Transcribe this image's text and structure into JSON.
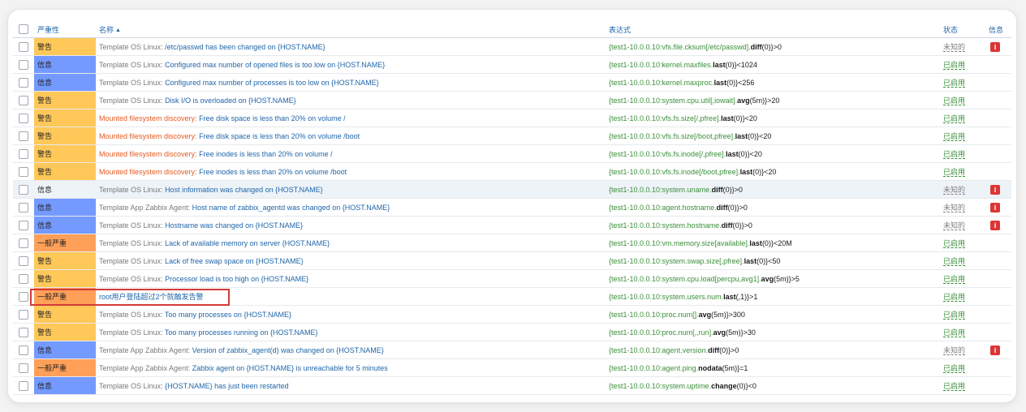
{
  "table": {
    "headers": {
      "severity": "严重性",
      "name": "名称",
      "expression": "表达式",
      "status": "状态",
      "info": "信息"
    },
    "rows": [
      {
        "severity": "警告",
        "sev_class": "warning",
        "template": "Template OS Linux",
        "name": "/etc/passwd has been changed on {HOST.NAME}",
        "expr_host": "{test1-10.0.0.10:vfs.file.cksum[/etc/passwd].",
        "expr_func": "diff",
        "expr_tail": "(0)}>0",
        "status": "未知的",
        "status_class": "unknown",
        "info": "i"
      },
      {
        "severity": "信息",
        "sev_class": "info",
        "template": "Template OS Linux",
        "name": "Configured max number of opened files is too low on {HOST.NAME}",
        "expr_host": "{test1-10.0.0.10:kernel.maxfiles.",
        "expr_func": "last",
        "expr_tail": "(0)}<1024",
        "status": "已启用",
        "status_class": "enabled",
        "info": ""
      },
      {
        "severity": "信息",
        "sev_class": "info",
        "template": "Template OS Linux",
        "name": "Configured max number of processes is too low on {HOST.NAME}",
        "expr_host": "{test1-10.0.0.10:kernel.maxproc.",
        "expr_func": "last",
        "expr_tail": "(0)}<256",
        "status": "已启用",
        "status_class": "enabled",
        "info": ""
      },
      {
        "severity": "警告",
        "sev_class": "warning",
        "template": "Template OS Linux",
        "name": "Disk I/O is overloaded on {HOST.NAME}",
        "expr_host": "{test1-10.0.0.10:system.cpu.util[,iowait].",
        "expr_func": "avg",
        "expr_tail": "(5m)}>20",
        "status": "已启用",
        "status_class": "enabled",
        "info": ""
      },
      {
        "severity": "警告",
        "sev_class": "warning",
        "template": "Mounted filesystem discovery",
        "template_class": "disc",
        "name": "Free disk space is less than 20% on volume /",
        "expr_host": "{test1-10.0.0.10:vfs.fs.size[/,pfree].",
        "expr_func": "last",
        "expr_tail": "(0)}<20",
        "status": "已启用",
        "status_class": "enabled",
        "info": ""
      },
      {
        "severity": "警告",
        "sev_class": "warning",
        "template": "Mounted filesystem discovery",
        "template_class": "disc",
        "name": "Free disk space is less than 20% on volume /boot",
        "expr_host": "{test1-10.0.0.10:vfs.fs.size[/boot,pfree].",
        "expr_func": "last",
        "expr_tail": "(0)}<20",
        "status": "已启用",
        "status_class": "enabled",
        "info": ""
      },
      {
        "severity": "警告",
        "sev_class": "warning",
        "template": "Mounted filesystem discovery",
        "template_class": "disc",
        "name": "Free inodes is less than 20% on volume /",
        "expr_host": "{test1-10.0.0.10:vfs.fs.inode[/,pfree].",
        "expr_func": "last",
        "expr_tail": "(0)}<20",
        "status": "已启用",
        "status_class": "enabled",
        "info": ""
      },
      {
        "severity": "警告",
        "sev_class": "warning",
        "template": "Mounted filesystem discovery",
        "template_class": "disc",
        "name": "Free inodes is less than 20% on volume /boot",
        "expr_host": "{test1-10.0.0.10:vfs.fs.inode[/boot,pfree].",
        "expr_func": "last",
        "expr_tail": "(0)}<20",
        "status": "已启用",
        "status_class": "enabled",
        "info": ""
      },
      {
        "severity": "信息",
        "sev_class": "info",
        "template": "Template OS Linux",
        "name": "Host information was changed on {HOST.NAME}",
        "expr_host": "{test1-10.0.0.10:system.uname.",
        "expr_func": "diff",
        "expr_tail": "(0)}>0",
        "status": "未知的",
        "status_class": "unknown",
        "info": "i",
        "highlight": true
      },
      {
        "severity": "信息",
        "sev_class": "info",
        "template": "Template App Zabbix Agent",
        "name": "Host name of zabbix_agentd was changed on {HOST.NAME}",
        "expr_host": "{test1-10.0.0.10:agent.hostname.",
        "expr_func": "diff",
        "expr_tail": "(0)}>0",
        "status": "未知的",
        "status_class": "unknown",
        "info": "i"
      },
      {
        "severity": "信息",
        "sev_class": "info",
        "template": "Template OS Linux",
        "name": "Hostname was changed on {HOST.NAME}",
        "expr_host": "{test1-10.0.0.10:system.hostname.",
        "expr_func": "diff",
        "expr_tail": "(0)}>0",
        "status": "未知的",
        "status_class": "unknown",
        "info": "i"
      },
      {
        "severity": "一般严重",
        "sev_class": "average",
        "template": "Template OS Linux",
        "name": "Lack of available memory on server {HOST.NAME}",
        "expr_host": "{test1-10.0.0.10:vm.memory.size[available].",
        "expr_func": "last",
        "expr_tail": "(0)}<20M",
        "status": "已启用",
        "status_class": "enabled",
        "info": ""
      },
      {
        "severity": "警告",
        "sev_class": "warning",
        "template": "Template OS Linux",
        "name": "Lack of free swap space on {HOST.NAME}",
        "expr_host": "{test1-10.0.0.10:system.swap.size[,pfree].",
        "expr_func": "last",
        "expr_tail": "(0)}<50",
        "status": "已启用",
        "status_class": "enabled",
        "info": ""
      },
      {
        "severity": "警告",
        "sev_class": "warning",
        "template": "Template OS Linux",
        "name": "Processor load is too high on {HOST.NAME}",
        "expr_host": "{test1-10.0.0.10:system.cpu.load[percpu,avg1].",
        "expr_func": "avg",
        "expr_tail": "(5m)}>5",
        "status": "已启用",
        "status_class": "enabled",
        "info": ""
      },
      {
        "severity": "一般严重",
        "sev_class": "average",
        "template": "",
        "name": "root用户登陆超过2个就触发告警",
        "expr_host": "{test1-10.0.0.10:system.users.num.",
        "expr_func": "last",
        "expr_tail": "(,1)}>1",
        "status": "已启用",
        "status_class": "enabled",
        "info": ""
      },
      {
        "severity": "警告",
        "sev_class": "warning",
        "template": "Template OS Linux",
        "name": "Too many processes on {HOST.NAME}",
        "expr_host": "{test1-10.0.0.10:proc.num[].",
        "expr_func": "avg",
        "expr_tail": "(5m)}>300",
        "status": "已启用",
        "status_class": "enabled",
        "info": ""
      },
      {
        "severity": "警告",
        "sev_class": "warning",
        "template": "Template OS Linux",
        "name": "Too many processes running on {HOST.NAME}",
        "expr_host": "{test1-10.0.0.10:proc.num[,,run].",
        "expr_func": "avg",
        "expr_tail": "(5m)}>30",
        "status": "已启用",
        "status_class": "enabled",
        "info": ""
      },
      {
        "severity": "信息",
        "sev_class": "info",
        "template": "Template App Zabbix Agent",
        "name": "Version of zabbix_agent(d) was changed on {HOST.NAME}",
        "expr_host": "{test1-10.0.0.10:agent.version.",
        "expr_func": "diff",
        "expr_tail": "(0)}>0",
        "status": "未知的",
        "status_class": "unknown",
        "info": "i"
      },
      {
        "severity": "一般严重",
        "sev_class": "average",
        "template": "Template App Zabbix Agent",
        "name": "Zabbix agent on {HOST.NAME} is unreachable for 5 minutes",
        "expr_host": "{test1-10.0.0.10:agent.ping.",
        "expr_func": "nodata",
        "expr_tail": "(5m)}=1",
        "status": "已启用",
        "status_class": "enabled",
        "info": ""
      },
      {
        "severity": "信息",
        "sev_class": "info",
        "template": "Template OS Linux",
        "name": "{HOST.NAME} has just been restarted",
        "expr_host": "{test1-10.0.0.10:system.uptime.",
        "expr_func": "change",
        "expr_tail": "(0)}<0",
        "status": "已启用",
        "status_class": "enabled",
        "info": ""
      }
    ]
  },
  "colors": {
    "warning": "#ffc859",
    "info": "#7499ff",
    "average": "#ffa059",
    "link": "#1f65a8",
    "expression": "#3a8f3a",
    "highlight_box": "#d43a3a",
    "info_icon": "#dc3535"
  },
  "icons": {
    "sort": "sort-asc-icon",
    "info": "info-icon"
  }
}
